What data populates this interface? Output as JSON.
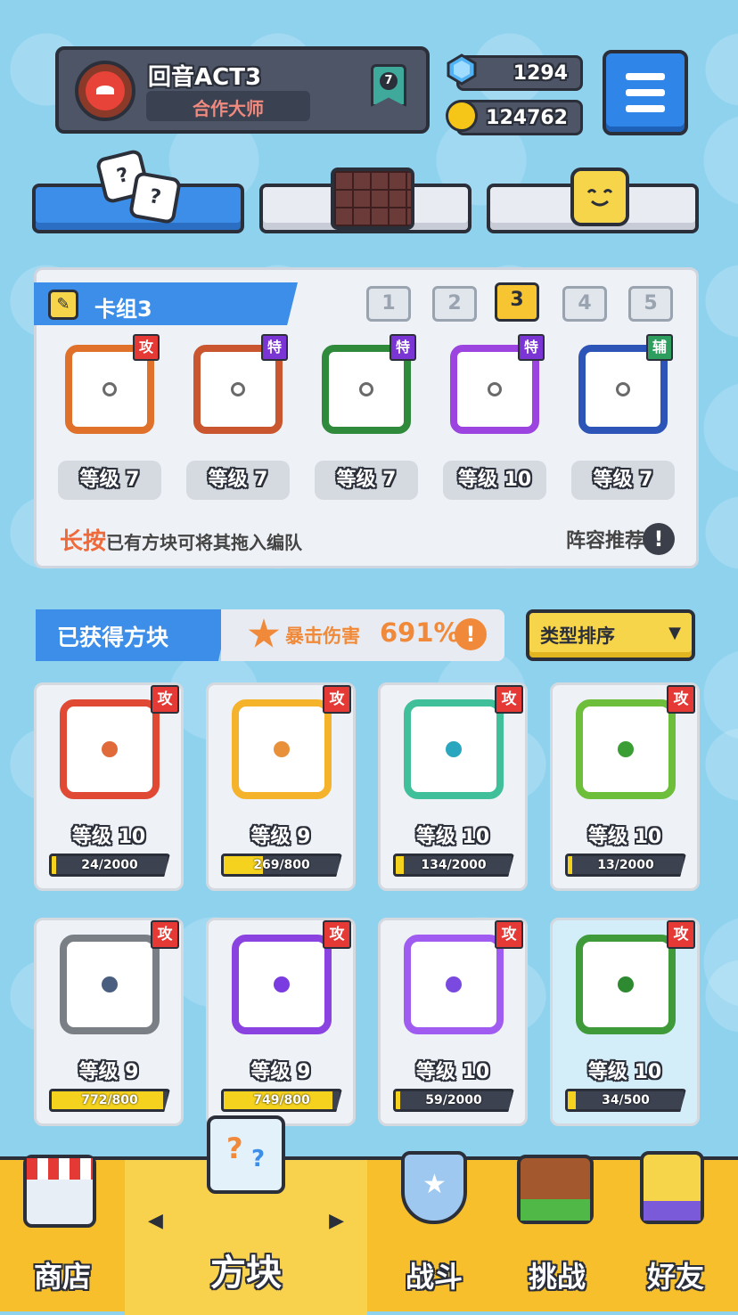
{
  "profile": {
    "name": "回音ACT3",
    "title": "合作大师",
    "rank": "7"
  },
  "currency": {
    "gems": "1294",
    "coins": "124762"
  },
  "icons": {
    "menu": "menu-icon",
    "gem": "gem-icon",
    "coin": "coin-icon",
    "pencil": "pencil-icon",
    "info": "info-icon"
  },
  "mode_tabs": [
    {
      "id": "dice",
      "icon": "dice-icon",
      "active": true
    },
    {
      "id": "board",
      "icon": "chocolate-board-icon",
      "active": false
    },
    {
      "id": "emote",
      "icon": "smiley-block-icon",
      "active": false
    }
  ],
  "deck": {
    "title": "卡组3",
    "numbers": [
      "1",
      "2",
      "3",
      "4",
      "5"
    ],
    "selected": "3",
    "cards": [
      {
        "badge": "攻",
        "badge_type": "atk",
        "level": "等级 7",
        "color": "#e0712b"
      },
      {
        "badge": "特",
        "badge_type": "spc",
        "level": "等级 7",
        "color": "#c9562e"
      },
      {
        "badge": "特",
        "badge_type": "spc",
        "level": "等级 7",
        "color": "#2f8a3c"
      },
      {
        "badge": "特",
        "badge_type": "spc",
        "level": "等级 10",
        "color": "#9b44e0"
      },
      {
        "badge": "辅",
        "badge_type": "sup",
        "level": "等级 7",
        "color": "#2d55b8"
      }
    ],
    "hint_em": "长按",
    "hint_rest": "已有方块可将其拖入编队",
    "recommend": "阵容推荐",
    "info_glyph": "!"
  },
  "acquired": {
    "title": "已获得方块",
    "crit_label": "暴击伤害",
    "crit_value": "691%",
    "crit_glyph": "!",
    "sort_label": "类型排序",
    "sort_arrow": "▼"
  },
  "blocks": [
    {
      "badge": "攻",
      "level": "等级 10",
      "progress": "24/2000",
      "fill": 0.012,
      "color": "#e04a35",
      "dot": "#e06a3a",
      "hl": false
    },
    {
      "badge": "攻",
      "level": "等级 9",
      "progress": "269/800",
      "fill": 0.336,
      "color": "#f5b32c",
      "dot": "#e8903a",
      "hl": false
    },
    {
      "badge": "攻",
      "level": "等级 10",
      "progress": "134/2000",
      "fill": 0.067,
      "color": "#3fbf9a",
      "dot": "#2aa7bf",
      "hl": false
    },
    {
      "badge": "攻",
      "level": "等级 10",
      "progress": "13/2000",
      "fill": 0.0065,
      "color": "#6dbe3a",
      "dot": "#3a9e34",
      "hl": false
    },
    {
      "badge": "攻",
      "level": "等级 9",
      "progress": "772/800",
      "fill": 0.965,
      "color": "#7a7f86",
      "dot": "#4a5f80",
      "hl": false
    },
    {
      "badge": "攻",
      "level": "等级 9",
      "progress": "749/800",
      "fill": 0.936,
      "color": "#8a42e0",
      "dot": "#7a3ce0",
      "hl": false
    },
    {
      "badge": "攻",
      "level": "等级 10",
      "progress": "59/2000",
      "fill": 0.0295,
      "color": "#a05cf0",
      "dot": "#7a4ae0",
      "hl": false
    },
    {
      "badge": "攻",
      "level": "等级 10",
      "progress": "34/500",
      "fill": 0.068,
      "color": "#3f9a3a",
      "dot": "#2e8a30",
      "hl": true
    }
  ],
  "nav": {
    "items": [
      {
        "label": "商店",
        "icon": "shop-icon"
      },
      {
        "label": "方块",
        "icon": "mystery-block-icon",
        "selected": true
      },
      {
        "label": "战斗",
        "icon": "battle-icon"
      },
      {
        "label": "挑战",
        "icon": "challenge-icon"
      },
      {
        "label": "好友",
        "icon": "friends-icon"
      }
    ],
    "arrow_left": "◀",
    "arrow_right": "▶"
  }
}
